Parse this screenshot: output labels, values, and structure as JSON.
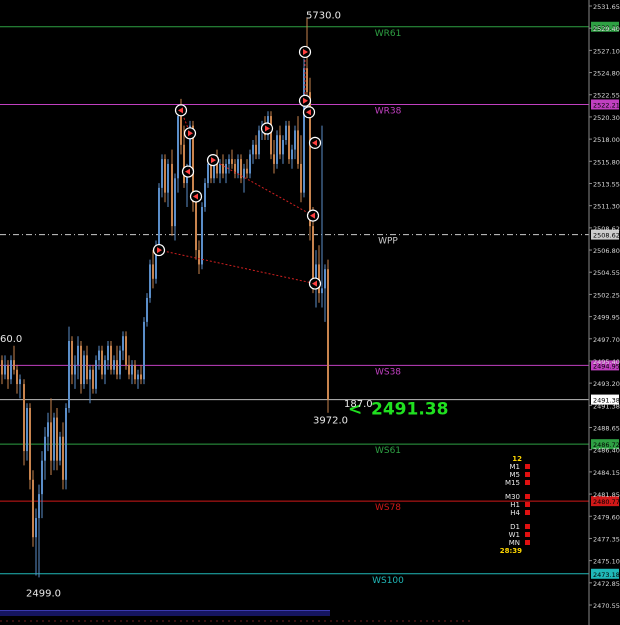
{
  "chart_data": {
    "type": "candlestick",
    "ylim": [
      2469.5,
      2532.5
    ],
    "y_ticks": [
      "2531.65",
      "2529.40",
      "2527.10",
      "2524.80",
      "2522.55",
      "2520.30",
      "2518.00",
      "2515.80",
      "2513.55",
      "2511.30",
      "2508.62",
      "2506.80",
      "2504.55",
      "2502.25",
      "2499.95",
      "2497.70",
      "2495.40",
      "2493.20",
      "2491.38",
      "2488.65",
      "2486.40",
      "2484.15",
      "2481.85",
      "2479.60",
      "2477.35",
      "2475.10",
      "2472.85",
      "2470.55"
    ],
    "levels": [
      {
        "name": "WR61",
        "value": 2530.33,
        "color": "#2ea043",
        "dashed": false
      },
      {
        "name": "WR38",
        "value": 2522.21,
        "color": "#c040c0",
        "dashed": false
      },
      {
        "name": "WPP",
        "value": 2508.62,
        "color": "#cccccc",
        "dashed": true
      },
      {
        "name": "WS38",
        "value": 2494.95,
        "color": "#c040c0",
        "dashed": false
      },
      {
        "name": "WS61",
        "value": 2486.72,
        "color": "#2ea043",
        "dashed": false
      },
      {
        "name": "WS78",
        "value": 2480.77,
        "color": "#d01818",
        "dashed": false
      },
      {
        "name": "WS100",
        "value": 2473.18,
        "color": "#20b8b8",
        "dashed": false
      }
    ],
    "current_price": {
      "value": 2491.38,
      "label": "2491.38",
      "color": "#20e020"
    },
    "annotations": [
      {
        "text": "5730.0",
        "x": 306,
        "y": 2531.2
      },
      {
        "text": "60.0",
        "x": 0,
        "y": 2497.4
      },
      {
        "text": "187.0",
        "x": 344,
        "y": 2490.6
      },
      {
        "text": "3972.0",
        "x": 313,
        "y": 2488.9
      },
      {
        "text": "2499.0",
        "x": 26,
        "y": 2470.8
      }
    ],
    "candles": [
      [
        2,
        2495.5,
        2496.0,
        2493.0,
        2494.0
      ],
      [
        5,
        2494.0,
        2496.0,
        2493.5,
        2495.0
      ],
      [
        8,
        2495.0,
        2495.5,
        2492.5,
        2493.5
      ],
      [
        11,
        2493.5,
        2496.0,
        2493.0,
        2495.5
      ],
      [
        14,
        2495.5,
        2497.0,
        2494.0,
        2494.5
      ],
      [
        17,
        2494.5,
        2495.0,
        2492.0,
        2493.0
      ],
      [
        20,
        2493.0,
        2494.0,
        2491.5,
        2493.5
      ],
      [
        24,
        2493.0,
        2493.5,
        2484.5,
        2486.0
      ],
      [
        27,
        2486.0,
        2491.0,
        2485.0,
        2490.5
      ],
      [
        30,
        2490.5,
        2491.0,
        2482.0,
        2483.0
      ],
      [
        33,
        2483.0,
        2484.0,
        2476.0,
        2477.0
      ],
      [
        36,
        2477.0,
        2480.0,
        2473.0,
        2479.0
      ],
      [
        39,
        2479.0,
        2482.5,
        2472.8,
        2481.5
      ],
      [
        42,
        2481.5,
        2486.0,
        2479.0,
        2485.0
      ],
      [
        45,
        2485.0,
        2488.5,
        2483.0,
        2487.5
      ],
      [
        48,
        2487.5,
        2490.0,
        2486.0,
        2489.0
      ],
      [
        51,
        2489.0,
        2491.5,
        2483.5,
        2485.0
      ],
      [
        54,
        2485.0,
        2490.0,
        2484.0,
        2489.5
      ],
      [
        57,
        2489.5,
        2490.5,
        2484.0,
        2485.0
      ],
      [
        60,
        2485.0,
        2488.0,
        2484.5,
        2487.5
      ],
      [
        63,
        2487.5,
        2489.0,
        2482.0,
        2483.0
      ],
      [
        66,
        2483.0,
        2491.0,
        2482.0,
        2490.5
      ],
      [
        69,
        2490.5,
        2499.0,
        2490.0,
        2497.5
      ],
      [
        72,
        2497.5,
        2498.0,
        2493.0,
        2494.0
      ],
      [
        75,
        2494.0,
        2496.0,
        2492.5,
        2495.0
      ],
      [
        78,
        2495.0,
        2498.0,
        2493.5,
        2497.0
      ],
      [
        81,
        2497.0,
        2497.5,
        2492.0,
        2493.0
      ],
      [
        84,
        2493.0,
        2496.5,
        2492.5,
        2496.0
      ],
      [
        87,
        2496.0,
        2497.0,
        2493.0,
        2493.5
      ],
      [
        90,
        2493.5,
        2495.0,
        2491.0,
        2494.5
      ],
      [
        93,
        2494.5,
        2495.0,
        2492.0,
        2492.5
      ],
      [
        96,
        2492.5,
        2496.0,
        2492.0,
        2495.5
      ],
      [
        99,
        2495.5,
        2497.0,
        2494.5,
        2496.5
      ],
      [
        102,
        2496.5,
        2497.0,
        2493.5,
        2494.0
      ],
      [
        105,
        2494.0,
        2496.0,
        2493.0,
        2495.5
      ],
      [
        108,
        2495.5,
        2497.5,
        2494.5,
        2497.0
      ],
      [
        111,
        2497.0,
        2497.5,
        2494.0,
        2494.5
      ],
      [
        114,
        2494.5,
        2496.0,
        2494.0,
        2495.5
      ],
      [
        117,
        2495.5,
        2497.0,
        2493.5,
        2494.0
      ],
      [
        120,
        2494.0,
        2497.0,
        2493.5,
        2496.5
      ],
      [
        123,
        2496.5,
        2498.5,
        2495.5,
        2498.0
      ],
      [
        126,
        2498.0,
        2498.5,
        2494.5,
        2495.0
      ],
      [
        129,
        2495.0,
        2496.0,
        2493.5,
        2494.0
      ],
      [
        132,
        2494.0,
        2495.5,
        2493.0,
        2495.0
      ],
      [
        135,
        2495.0,
        2495.5,
        2493.0,
        2493.5
      ],
      [
        138,
        2493.5,
        2494.5,
        2492.5,
        2494.0
      ],
      [
        141,
        2494.0,
        2495.0,
        2493.0,
        2493.5
      ],
      [
        144,
        2493.5,
        2500.0,
        2493.0,
        2499.5
      ],
      [
        147,
        2499.5,
        2502.5,
        2499.0,
        2502.0
      ],
      [
        150,
        2502.0,
        2506.0,
        2501.5,
        2505.5
      ],
      [
        153,
        2505.5,
        2507.0,
        2503.0,
        2504.0
      ],
      [
        156,
        2504.0,
        2508.0,
        2503.5,
        2507.5
      ],
      [
        159,
        2507.5,
        2514.0,
        2506.5,
        2513.5
      ],
      [
        162,
        2513.5,
        2517.0,
        2512.5,
        2516.5
      ],
      [
        165,
        2516.5,
        2517.0,
        2512.0,
        2513.0
      ],
      [
        168,
        2513.0,
        2516.5,
        2511.5,
        2516.0
      ],
      [
        172,
        2516.0,
        2517.5,
        2508.5,
        2509.5
      ],
      [
        175,
        2509.5,
        2515.0,
        2508.0,
        2514.5
      ],
      [
        178,
        2514.5,
        2521.5,
        2513.0,
        2521.0
      ],
      [
        181,
        2521.0,
        2522.8,
        2517.0,
        2518.0
      ],
      [
        184,
        2518.0,
        2520.0,
        2513.5,
        2514.0
      ],
      [
        187,
        2514.0,
        2516.0,
        2511.5,
        2515.5
      ],
      [
        190,
        2515.5,
        2520.5,
        2515.0,
        2520.0
      ],
      [
        193,
        2520.0,
        2520.5,
        2511.0,
        2512.0
      ],
      [
        196,
        2512.0,
        2513.0,
        2506.0,
        2507.0
      ],
      [
        199,
        2507.0,
        2508.0,
        2504.5,
        2505.5
      ],
      [
        202,
        2505.5,
        2512.0,
        2505.0,
        2511.5
      ],
      [
        205,
        2511.5,
        2514.5,
        2511.0,
        2514.0
      ],
      [
        208,
        2514.0,
        2516.5,
        2513.5,
        2516.0
      ],
      [
        211,
        2516.0,
        2517.0,
        2514.0,
        2514.5
      ],
      [
        214,
        2514.5,
        2516.5,
        2514.0,
        2516.0
      ],
      [
        217,
        2516.0,
        2517.5,
        2514.5,
        2515.0
      ],
      [
        220,
        2515.0,
        2516.5,
        2514.0,
        2516.0
      ],
      [
        223,
        2516.0,
        2517.0,
        2514.5,
        2515.0
      ],
      [
        226,
        2515.0,
        2516.5,
        2514.0,
        2516.0
      ],
      [
        229,
        2516.0,
        2517.0,
        2515.0,
        2516.5
      ],
      [
        232,
        2516.5,
        2517.5,
        2515.5,
        2516.0
      ],
      [
        235,
        2516.0,
        2516.5,
        2514.5,
        2515.0
      ],
      [
        238,
        2515.0,
        2517.0,
        2514.5,
        2516.5
      ],
      [
        241,
        2516.5,
        2517.0,
        2514.0,
        2514.5
      ],
      [
        244,
        2514.5,
        2516.0,
        2513.0,
        2515.5
      ],
      [
        247,
        2515.5,
        2516.5,
        2514.5,
        2515.0
      ],
      [
        250,
        2515.0,
        2517.5,
        2514.5,
        2517.0
      ],
      [
        253,
        2517.0,
        2518.5,
        2516.0,
        2518.0
      ],
      [
        256,
        2518.0,
        2519.0,
        2516.5,
        2517.0
      ],
      [
        259,
        2517.0,
        2520.0,
        2516.5,
        2519.5
      ],
      [
        262,
        2519.5,
        2520.5,
        2518.5,
        2520.0
      ],
      [
        265,
        2520.0,
        2521.0,
        2518.5,
        2519.0
      ],
      [
        268,
        2519.0,
        2521.5,
        2518.5,
        2521.0
      ],
      [
        271,
        2521.0,
        2521.5,
        2516.5,
        2517.0
      ],
      [
        274,
        2517.0,
        2518.5,
        2515.0,
        2516.0
      ],
      [
        277,
        2516.0,
        2519.5,
        2515.5,
        2519.0
      ],
      [
        280,
        2519.0,
        2520.0,
        2516.5,
        2517.0
      ],
      [
        283,
        2517.0,
        2519.0,
        2516.0,
        2518.5
      ],
      [
        286,
        2518.5,
        2520.5,
        2518.0,
        2520.0
      ],
      [
        289,
        2520.0,
        2520.5,
        2516.0,
        2516.5
      ],
      [
        292,
        2516.5,
        2518.0,
        2515.5,
        2517.5
      ],
      [
        295,
        2517.5,
        2520.0,
        2516.5,
        2519.5
      ],
      [
        298,
        2519.5,
        2521.0,
        2515.5,
        2516.0
      ],
      [
        301,
        2516.0,
        2519.0,
        2512.0,
        2513.0
      ],
      [
        304,
        2513.0,
        2527.0,
        2512.5,
        2526.0
      ],
      [
        307,
        2526.0,
        2531.3,
        2522.5,
        2523.5
      ],
      [
        310,
        2523.5,
        2525.0,
        2508.0,
        2509.5
      ],
      [
        313,
        2509.5,
        2511.5,
        2502.5,
        2503.5
      ],
      [
        316,
        2503.5,
        2507.0,
        2501.0,
        2505.5
      ],
      [
        319,
        2505.5,
        2507.5,
        2501.5,
        2502.5
      ],
      [
        322,
        2502.5,
        2520.0,
        2501.0,
        2503.0
      ],
      [
        325,
        2503.0,
        2505.5,
        2499.5,
        2505.0
      ],
      [
        328,
        2505.0,
        2506.0,
        2490.0,
        2491.38
      ]
    ],
    "markers": [
      [
        159,
        2507.0,
        "r"
      ],
      [
        181,
        2521.6,
        "l"
      ],
      [
        190,
        2519.2,
        "r"
      ],
      [
        188,
        2515.2,
        "l"
      ],
      [
        196,
        2512.6,
        "l"
      ],
      [
        213,
        2516.4,
        "r"
      ],
      [
        267,
        2519.7,
        "r"
      ],
      [
        305,
        2527.7,
        "r"
      ],
      [
        305,
        2522.6,
        "r"
      ],
      [
        309,
        2521.4,
        "l"
      ],
      [
        315,
        2518.2,
        "l"
      ],
      [
        313,
        2510.6,
        "l"
      ],
      [
        315,
        2503.5,
        "l"
      ]
    ],
    "dotted_links": [
      [
        [
          159,
          2507.0
        ],
        [
          315,
          2503.5
        ]
      ],
      [
        [
          213,
          2516.4
        ],
        [
          313,
          2510.6
        ]
      ],
      [
        [
          305,
          2527.7
        ],
        [
          305,
          2522.6
        ]
      ],
      [
        [
          181,
          2521.6
        ],
        [
          190,
          2519.2
        ]
      ]
    ]
  },
  "timeframes": {
    "count": "12",
    "groups": [
      [
        "M1",
        "M5",
        "M15"
      ],
      [
        "M30",
        "H1",
        "H4"
      ],
      [
        "D1",
        "W1",
        "MN"
      ]
    ],
    "countdown": "28:39"
  }
}
